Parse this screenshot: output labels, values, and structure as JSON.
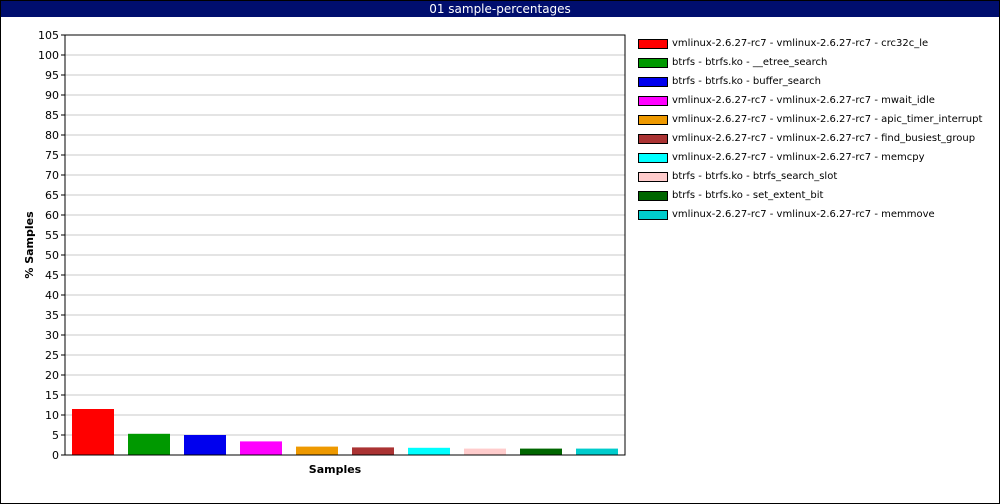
{
  "window": {
    "title": "01 sample-percentages"
  },
  "chart_data": {
    "type": "bar",
    "title": "01 sample-percentages",
    "xlabel": "Samples",
    "ylabel": "% Samples",
    "ylim": [
      0,
      105
    ],
    "ytick_step": 5,
    "grid": true,
    "legend_position": "right",
    "series": [
      {
        "name": "vmlinux-2.6.27-rc7 - vmlinux-2.6.27-rc7 - crc32c_le",
        "value": 11.5,
        "color": "#ff0000"
      },
      {
        "name": "btrfs - btrfs.ko - __etree_search",
        "value": 5.3,
        "color": "#009900"
      },
      {
        "name": "btrfs - btrfs.ko - buffer_search",
        "value": 5.0,
        "color": "#0000ee"
      },
      {
        "name": "vmlinux-2.6.27-rc7 - vmlinux-2.6.27-rc7 - mwait_idle",
        "value": 3.4,
        "color": "#ff00ff"
      },
      {
        "name": "vmlinux-2.6.27-rc7 - vmlinux-2.6.27-rc7 - apic_timer_interrupt",
        "value": 2.1,
        "color": "#ee9900"
      },
      {
        "name": "vmlinux-2.6.27-rc7 - vmlinux-2.6.27-rc7 - find_busiest_group",
        "value": 1.9,
        "color": "#aa3333"
      },
      {
        "name": "vmlinux-2.6.27-rc7 - vmlinux-2.6.27-rc7 - memcpy",
        "value": 1.8,
        "color": "#00ffff"
      },
      {
        "name": "btrfs - btrfs.ko - btrfs_search_slot",
        "value": 1.6,
        "color": "#ffcccc"
      },
      {
        "name": "btrfs - btrfs.ko - set_extent_bit",
        "value": 1.6,
        "color": "#006600"
      },
      {
        "name": "vmlinux-2.6.27-rc7 - vmlinux-2.6.27-rc7 - memmove",
        "value": 1.6,
        "color": "#00cccc"
      }
    ]
  }
}
